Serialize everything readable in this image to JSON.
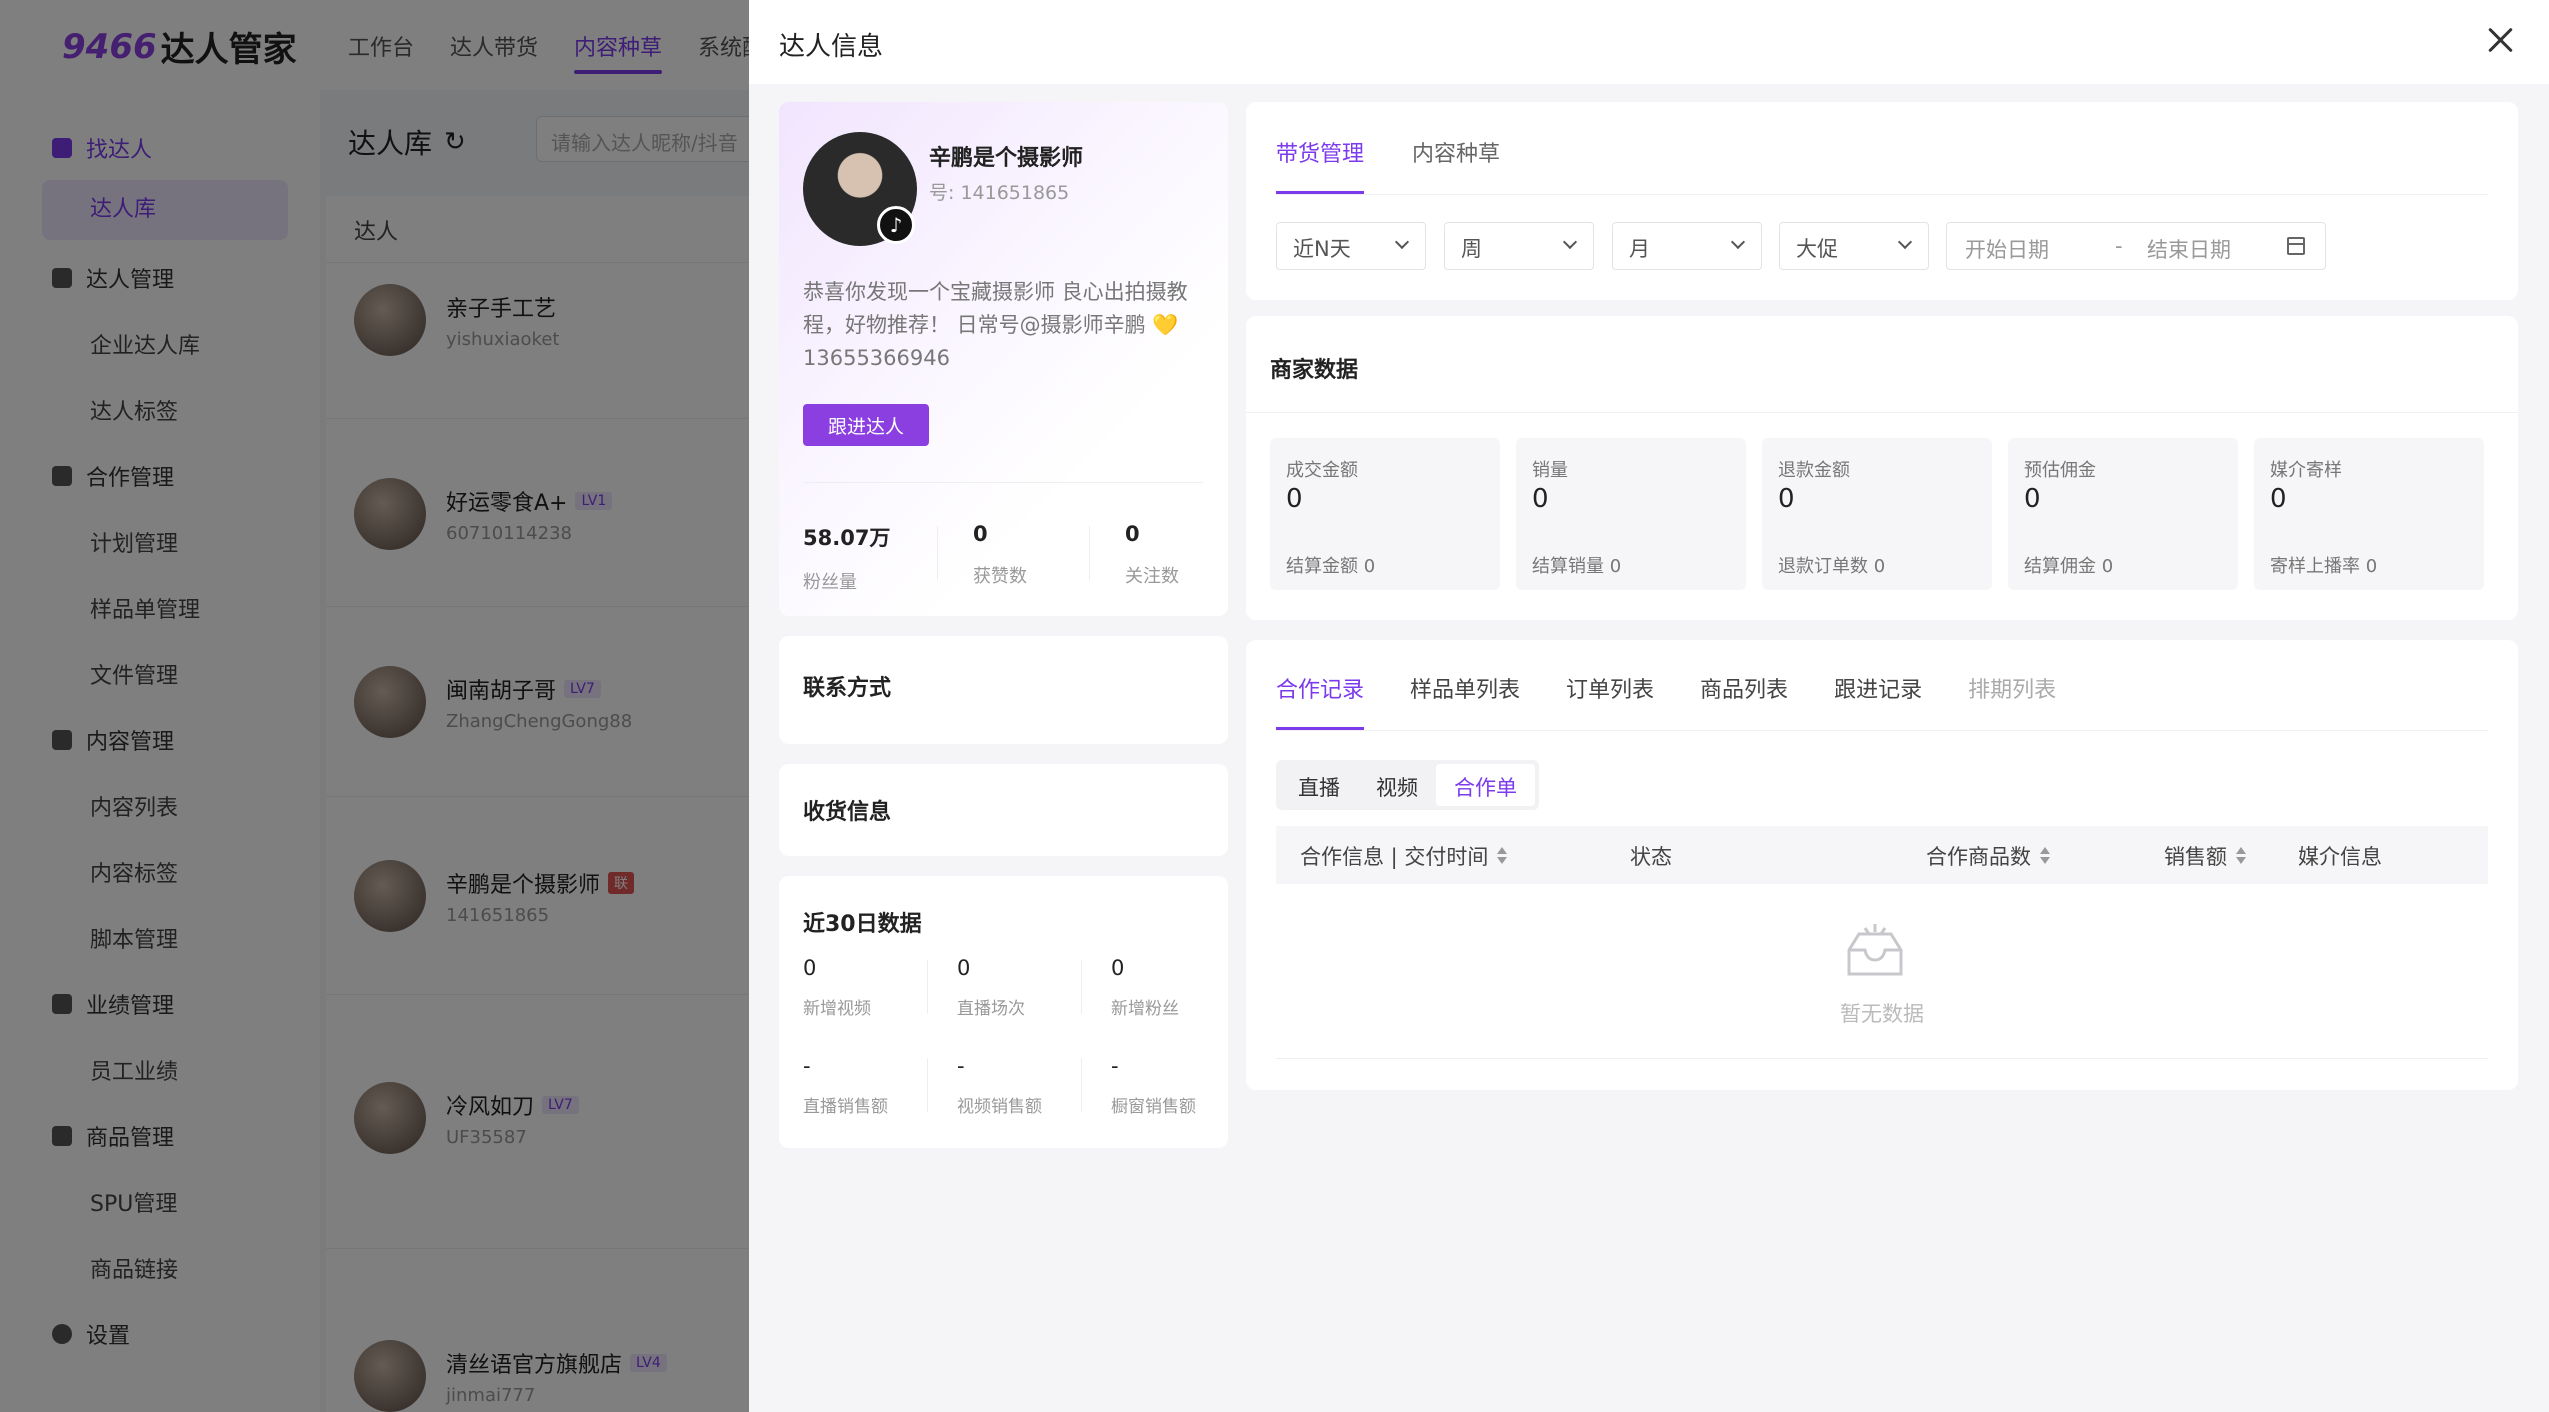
{
  "app": {
    "logo_num": "9466",
    "logo_text": "达人管家",
    "topnav": [
      "工作台",
      "达人带货",
      "内容种草",
      "系统配"
    ],
    "sidebar": {
      "find": "找达人",
      "library": "达人库",
      "manage": "达人管理",
      "enterprise": "企业达人库",
      "tags": "达人标签",
      "coop": "合作管理",
      "plan": "计划管理",
      "sample": "样品单管理",
      "file": "文件管理",
      "content": "内容管理",
      "content_list": "内容列表",
      "content_tags": "内容标签",
      "script": "脚本管理",
      "perf": "业绩管理",
      "staff_perf": "员工业绩",
      "goods": "商品管理",
      "spu": "SPU管理",
      "goods_link": "商品链接",
      "settings": "设置"
    },
    "library": {
      "title": "达人库",
      "search_placeholder": "请输入达人昵称/抖音",
      "column": "达人",
      "rows": [
        {
          "name": "亲子手工艺",
          "lv": "",
          "id": "yishuxiaoket"
        },
        {
          "name": "好运零食A+",
          "lv": "LV1",
          "id": "60710114238"
        },
        {
          "name": "闽南胡子哥",
          "lv": "LV7",
          "id": "ZhangChengGong88"
        },
        {
          "name": "辛鹏是个摄影师",
          "lv": "联",
          "id": "141651865"
        },
        {
          "name": "冷风如刀",
          "lv": "LV7",
          "id": "UF35587"
        },
        {
          "name": "清丝语官方旗舰店",
          "lv": "LV4",
          "id": "jinmai777"
        }
      ]
    }
  },
  "drawer": {
    "title": "达人信息",
    "profile": {
      "name": "辛鹏是个摄影师",
      "id": "号: 141651865",
      "bio": "恭喜你发现一个宝藏摄影师 良心出拍摄教程，好物推荐！ 日常号@摄影师辛鹏 💛 13655366946",
      "follow_label": "跟进达人",
      "stats": [
        {
          "value": "58.07万",
          "label": "粉丝量"
        },
        {
          "value": "0",
          "label": "获赞数"
        },
        {
          "value": "0",
          "label": "关注数"
        }
      ]
    },
    "contact_title": "联系方式",
    "shipping_title": "收货信息",
    "recent": {
      "title": "近30日数据",
      "stats": [
        {
          "value": "0",
          "label": "新增视频"
        },
        {
          "value": "0",
          "label": "直播场次"
        },
        {
          "value": "0",
          "label": "新增粉丝"
        },
        {
          "value": "-",
          "label": "直播销售额"
        },
        {
          "value": "-",
          "label": "视频销售额"
        },
        {
          "value": "-",
          "label": "橱窗销售额"
        }
      ]
    },
    "tabs": [
      "带货管理",
      "内容种草"
    ],
    "filters": {
      "n_days": "近N天",
      "week": "周",
      "month": "月",
      "promo": "大促",
      "start_date": "开始日期",
      "dash": "-",
      "end_date": "结束日期"
    },
    "merchant": {
      "title": "商家数据",
      "boxes": [
        {
          "label": "成交金额",
          "value": "0",
          "sub": "结算金额 0"
        },
        {
          "label": "销量",
          "value": "0",
          "sub": "结算销量 0"
        },
        {
          "label": "退款金额",
          "value": "0",
          "sub": "退款订单数 0"
        },
        {
          "label": "预估佣金",
          "value": "0",
          "sub": "结算佣金 0"
        },
        {
          "label": "媒介寄样",
          "value": "0",
          "sub": "寄样上播率 0"
        }
      ]
    },
    "records": {
      "tabs": [
        "合作记录",
        "样品单列表",
        "订单列表",
        "商品列表",
        "跟进记录",
        "排期列表"
      ],
      "segments": [
        "直播",
        "视频",
        "合作单"
      ],
      "columns": [
        "合作信息 | 交付时间",
        "状态",
        "合作商品数",
        "销售额",
        "媒介信息"
      ],
      "empty": "暂无数据"
    }
  }
}
